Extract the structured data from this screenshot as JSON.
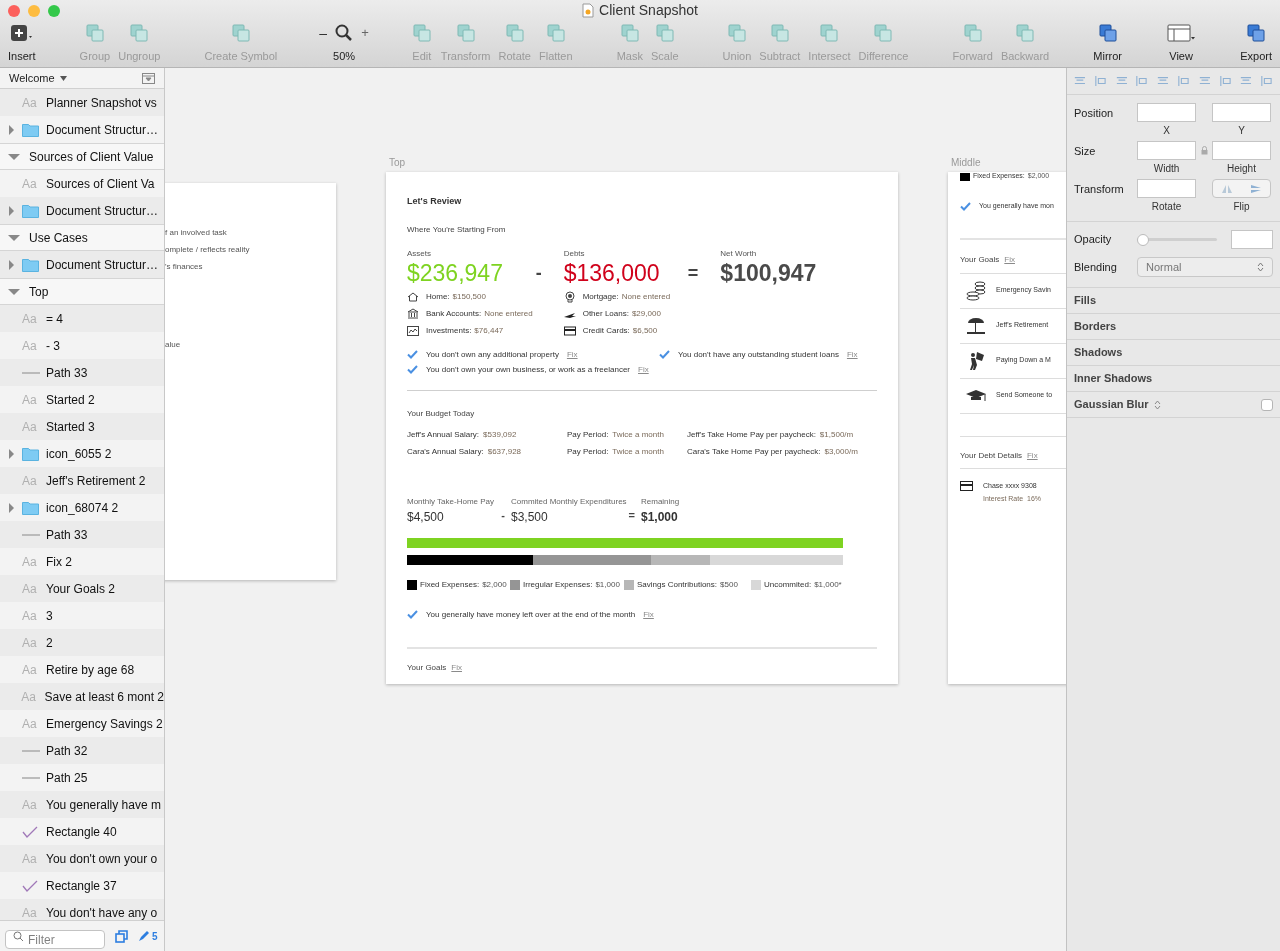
{
  "window": {
    "title": "Client Snapshot"
  },
  "toolbar": {
    "groups": [
      [
        {
          "kind": "menu",
          "label": "Insert",
          "disabled": false
        }
      ],
      [
        {
          "kind": "button",
          "label": "Group",
          "disabled": true
        },
        {
          "kind": "button",
          "label": "Ungroup",
          "disabled": true
        }
      ],
      [
        {
          "kind": "button",
          "label": "Create Symbol",
          "disabled": true
        }
      ],
      [
        {
          "kind": "zoom",
          "label": "50%",
          "minus": "–",
          "plus": "+",
          "disabled": false
        }
      ],
      [
        {
          "kind": "button",
          "label": "Edit",
          "disabled": true
        },
        {
          "kind": "button",
          "label": "Transform",
          "disabled": true
        },
        {
          "kind": "button",
          "label": "Rotate",
          "disabled": true
        },
        {
          "kind": "button",
          "label": "Flatten",
          "disabled": true
        }
      ],
      [
        {
          "kind": "button",
          "label": "Mask",
          "disabled": true
        },
        {
          "kind": "button",
          "label": "Scale",
          "disabled": true
        }
      ],
      [
        {
          "kind": "button",
          "label": "Union",
          "disabled": true
        },
        {
          "kind": "button",
          "label": "Subtract",
          "disabled": true
        },
        {
          "kind": "button",
          "label": "Intersect",
          "disabled": true
        },
        {
          "kind": "button",
          "label": "Difference",
          "disabled": true
        }
      ],
      [
        {
          "kind": "button",
          "label": "Forward",
          "disabled": true
        },
        {
          "kind": "button",
          "label": "Backward",
          "disabled": true
        }
      ],
      [
        {
          "kind": "button",
          "label": "Mirror",
          "disabled": false
        }
      ],
      [
        {
          "kind": "menu",
          "label": "View",
          "disabled": false
        }
      ],
      [
        {
          "kind": "button",
          "label": "Export",
          "disabled": false
        }
      ]
    ]
  },
  "sidebar": {
    "page": "Welcome",
    "layers": [
      {
        "kind": "text",
        "glyph": "Aa",
        "name": "Planner Snapshot vs"
      },
      {
        "kind": "folder",
        "name": "Document Structur…",
        "expanded": false
      },
      {
        "kind": "artboard",
        "name": "Sources of Client Value",
        "expanded": true
      },
      {
        "kind": "text",
        "glyph": "Aa",
        "name": "Sources of Client Va"
      },
      {
        "kind": "folder",
        "name": "Document Structur…",
        "expanded": false
      },
      {
        "kind": "artboard",
        "name": "Use Cases",
        "expanded": true
      },
      {
        "kind": "folder",
        "name": "Document Structur…",
        "expanded": false
      },
      {
        "kind": "artboard",
        "name": "Top",
        "expanded": true
      },
      {
        "kind": "text",
        "glyph": "Aa",
        "name": "= 4"
      },
      {
        "kind": "text",
        "glyph": "Aa",
        "name": "- 3"
      },
      {
        "kind": "path",
        "name": "Path 33"
      },
      {
        "kind": "text",
        "glyph": "Aa",
        "name": "Started 2"
      },
      {
        "kind": "text",
        "glyph": "Aa",
        "name": "Started 3"
      },
      {
        "kind": "folder",
        "name": "icon_6055 2",
        "expanded": false
      },
      {
        "kind": "text",
        "glyph": "Aa",
        "name": "Jeff's Retirement 2"
      },
      {
        "kind": "folder",
        "name": "icon_68074 2",
        "expanded": false
      },
      {
        "kind": "path",
        "name": "Path 33"
      },
      {
        "kind": "text",
        "glyph": "Aa",
        "name": "Fix 2"
      },
      {
        "kind": "text",
        "glyph": "Aa",
        "name": "Your Goals 2"
      },
      {
        "kind": "text",
        "glyph": "Aa",
        "name": "3"
      },
      {
        "kind": "text",
        "glyph": "Aa",
        "name": "2"
      },
      {
        "kind": "text",
        "glyph": "Aa",
        "name": "Retire by age 68"
      },
      {
        "kind": "text",
        "glyph": "Aa",
        "name": "Save at least 6 mont 2"
      },
      {
        "kind": "text",
        "glyph": "Aa",
        "name": "Emergency Savings 2"
      },
      {
        "kind": "path",
        "name": "Path 32"
      },
      {
        "kind": "path",
        "name": "Path 25"
      },
      {
        "kind": "text",
        "glyph": "Aa",
        "name": "You generally have m"
      },
      {
        "kind": "shape",
        "name": "Rectangle 40"
      },
      {
        "kind": "text",
        "glyph": "Aa",
        "name": "You don't own your o"
      },
      {
        "kind": "shape",
        "name": "Rectangle 37"
      },
      {
        "kind": "text",
        "glyph": "Aa",
        "name": "You don't have any o"
      }
    ],
    "filter": {
      "placeholder": "Filter"
    },
    "edits_count": "5"
  },
  "canvas": {
    "left_artboard": {
      "lines": [
        "f an involved task",
        "omplete / reflects reality",
        "'s finances"
      ],
      "note": "alue"
    },
    "top_artboard": {
      "label": "Top",
      "title": "Let's Review",
      "subtitle": "Where You're Starting From",
      "columns": [
        {
          "caption": "Assets",
          "value": "$236,947",
          "kind": "positive",
          "operator": "-",
          "items": [
            {
              "label": "Home:",
              "value": "$150,500"
            },
            {
              "label": "Bank Accounts:",
              "value": "None entered"
            },
            {
              "label": "Investments:",
              "value": "$76,447"
            }
          ]
        },
        {
          "caption": "Debts",
          "value": "$136,000",
          "kind": "negative",
          "operator": "=",
          "items": [
            {
              "label": "Mortgage:",
              "value": "None entered"
            },
            {
              "label": "Other Loans:",
              "value": "$29,000"
            },
            {
              "label": "Credit Cards:",
              "value": "$6,500"
            }
          ]
        },
        {
          "caption": "Net Worth",
          "value": "$100,947",
          "kind": "neutral"
        }
      ],
      "checks": [
        [
          {
            "text": "You don't own any additional property",
            "link": "Fix",
            "checked": true
          },
          {
            "text": "You don't own your own business, or work as a freelancer",
            "link": "Fix",
            "checked": true
          }
        ],
        [
          {
            "text": "You don't have any outstanding student loans",
            "link": "Fix",
            "checked": true
          }
        ]
      ],
      "budget": {
        "title": "Your Budget Today",
        "rows": [
          [
            {
              "label": "Jeff's Annual Salary:",
              "value": "$539,092"
            },
            {
              "label": "Pay Period:",
              "value": "Twice a month"
            },
            {
              "label": "Jeff's Take Home Pay per paycheck:",
              "value": "$1,500/m"
            }
          ],
          [
            {
              "label": "Cara's Annual Salary:",
              "value": "$637,928"
            },
            {
              "label": "Pay Period:",
              "value": "Twice a month"
            },
            {
              "label": "Cara's Take Home Pay per paycheck:",
              "value": "$3,000/m"
            }
          ]
        ]
      },
      "monthly": [
        {
          "caption": "Monthly Take-Home Pay",
          "value": "$4,500",
          "bold": false,
          "operator": "-"
        },
        {
          "caption": "Commited Monthly Expenditures",
          "value": "$3,500",
          "bold": false,
          "operator": "="
        },
        {
          "caption": "Remaining",
          "value": "$1,000",
          "bold": true
        }
      ],
      "segments": [
        {
          "label": "Fixed Expenses:",
          "value": "$2,000",
          "color": "#000000"
        },
        {
          "label": "Irregular Expenses:",
          "value": "$1,000",
          "color": "#959595"
        },
        {
          "label": "Savings Contributions:",
          "value": "$500",
          "color": "#b7b7b7"
        },
        {
          "label": "Uncommited:",
          "value": "$1,000*",
          "color": "#d8d8d8"
        }
      ],
      "check": {
        "text": "You generally have money left over at the end of the month",
        "link": "Fix",
        "checked": true
      },
      "goals": {
        "title": "Your Goals",
        "link": "Fix"
      }
    },
    "middle_artboard": {
      "label": "Middle",
      "legend": {
        "label": "Fixed Expenses:",
        "value": "$2,000",
        "color": "#000000"
      },
      "check": {
        "text": "You generally have mon",
        "checked": true
      },
      "goals": {
        "title": "Your Goals",
        "link": "Fix",
        "items": [
          "Emergency Savin",
          "Jeff's Retirement",
          "Paying Down a M",
          "Send Someone to"
        ]
      },
      "debts": {
        "title": "Your Debt Details",
        "link": "Fix",
        "items": [
          {
            "name": "Chase xxxx 9308",
            "rate_label": "Interest Rate",
            "rate": "16%"
          }
        ]
      }
    }
  },
  "inspector": {
    "rows": [
      {
        "label": "Position",
        "fields": [
          "X",
          "Y"
        ]
      },
      {
        "label": "Size",
        "fields": [
          "Width",
          "Height"
        ]
      }
    ],
    "transform": {
      "label": "Transform",
      "field": "Rotate",
      "flip": "Flip"
    },
    "opacity": {
      "label": "Opacity",
      "level": 0
    },
    "blending": {
      "label": "Blending",
      "value": "Normal"
    },
    "sections": [
      {
        "kind": "plain",
        "label": "Fills"
      },
      {
        "kind": "plain",
        "label": "Borders"
      },
      {
        "kind": "plain",
        "label": "Shadows"
      },
      {
        "kind": "plain",
        "label": "Inner Shadows"
      },
      {
        "kind": "toggle",
        "label": "Gaussian Blur",
        "checked": false
      }
    ]
  }
}
